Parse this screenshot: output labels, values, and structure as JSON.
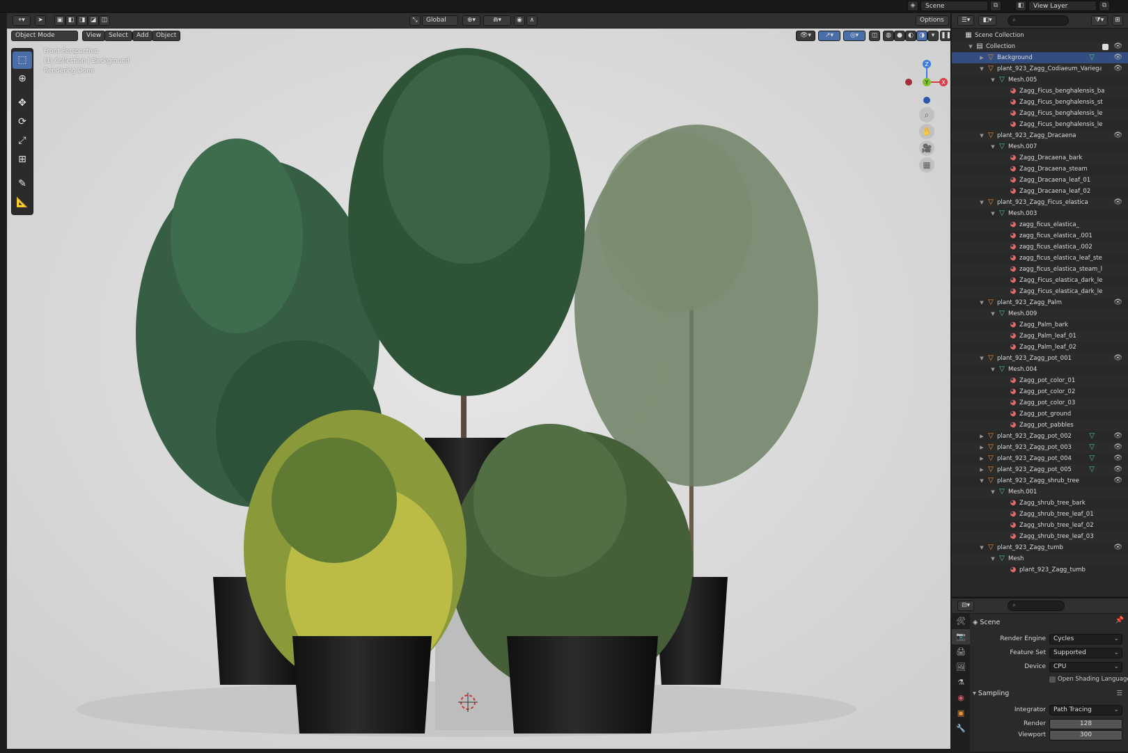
{
  "topbar": {
    "scene_label": "Scene",
    "view_layer_label": "View Layer"
  },
  "viewport": {
    "mode_label": "Object Mode",
    "menus": [
      "View",
      "Select",
      "Add",
      "Object"
    ],
    "transform_label": "Global",
    "options_label": "Options",
    "overlay_lines": [
      "Front Perspective",
      "(1) Collection | Background",
      "Rendering Done"
    ],
    "gizmo_axes": {
      "z": "Z",
      "y": "Y",
      "x": "X"
    },
    "colors": {
      "background": "#dcdcdc",
      "header": "#303030",
      "active_tool": "#4a6ea8"
    }
  },
  "outliner": {
    "search_placeholder": "",
    "rows": [
      {
        "label": "Scene Collection",
        "type": "scene",
        "depth": 0,
        "expand": ""
      },
      {
        "label": "Collection",
        "type": "collection",
        "depth": 1,
        "expand": "▼",
        "check": true,
        "eye": true
      },
      {
        "label": "Background",
        "type": "object",
        "depth": 2,
        "expand": "▶",
        "eye": true,
        "selected": true,
        "tail": "mesh"
      },
      {
        "label": "plant_923_Zagg_Codiaeum_Variega",
        "type": "object",
        "depth": 2,
        "expand": "▼",
        "eye": true
      },
      {
        "label": "Mesh.005",
        "type": "mesh",
        "depth": 3,
        "expand": "▼"
      },
      {
        "label": "Zagg_Ficus_benghalensis_ba",
        "type": "material",
        "depth": 4
      },
      {
        "label": "Zagg_Ficus_benghalensis_st",
        "type": "material",
        "depth": 4
      },
      {
        "label": "Zagg_Ficus_benghalensis_le",
        "type": "material",
        "depth": 4
      },
      {
        "label": "Zagg_Ficus_benghalensis_le",
        "type": "material",
        "depth": 4
      },
      {
        "label": "plant_923_Zagg_Dracaena",
        "type": "object",
        "depth": 2,
        "expand": "▼",
        "eye": true
      },
      {
        "label": "Mesh.007",
        "type": "mesh",
        "depth": 3,
        "expand": "▼"
      },
      {
        "label": "Zagg_Dracaena_bark",
        "type": "material",
        "depth": 4
      },
      {
        "label": "Zagg_Dracaena_steam",
        "type": "material",
        "depth": 4
      },
      {
        "label": "Zagg_Dracaena_leaf_01",
        "type": "material",
        "depth": 4
      },
      {
        "label": "Zagg_Dracaena_leaf_02",
        "type": "material",
        "depth": 4
      },
      {
        "label": "plant_923_Zagg_Ficus_elastica",
        "type": "object",
        "depth": 2,
        "expand": "▼",
        "eye": true
      },
      {
        "label": "Mesh.003",
        "type": "mesh",
        "depth": 3,
        "expand": "▼"
      },
      {
        "label": "zagg_ficus_elastica_",
        "type": "material",
        "depth": 4
      },
      {
        "label": "zagg_ficus_elastica_.001",
        "type": "material",
        "depth": 4
      },
      {
        "label": "zagg_ficus_elastica_.002",
        "type": "material",
        "depth": 4
      },
      {
        "label": "zagg_ficus_elastica_leaf_ste",
        "type": "material",
        "depth": 4
      },
      {
        "label": "zagg_ficus_elastica_steam_l",
        "type": "material",
        "depth": 4
      },
      {
        "label": "Zagg_Ficus_elastica_dark_le",
        "type": "material",
        "depth": 4
      },
      {
        "label": "Zagg_Ficus_elastica_dark_le",
        "type": "material",
        "depth": 4
      },
      {
        "label": "plant_923_Zagg_Palm",
        "type": "object",
        "depth": 2,
        "expand": "▼",
        "eye": true
      },
      {
        "label": "Mesh.009",
        "type": "mesh",
        "depth": 3,
        "expand": "▼"
      },
      {
        "label": "Zagg_Palm_bark",
        "type": "material",
        "depth": 4
      },
      {
        "label": "Zagg_Palm_leaf_01",
        "type": "material",
        "depth": 4
      },
      {
        "label": "Zagg_Palm_leaf_02",
        "type": "material",
        "depth": 4
      },
      {
        "label": "plant_923_Zagg_pot_001",
        "type": "object",
        "depth": 2,
        "expand": "▼",
        "eye": true
      },
      {
        "label": "Mesh.004",
        "type": "mesh",
        "depth": 3,
        "expand": "▼"
      },
      {
        "label": "Zagg_pot_color_01",
        "type": "material",
        "depth": 4
      },
      {
        "label": "Zagg_pot_color_02",
        "type": "material",
        "depth": 4
      },
      {
        "label": "Zagg_pot_color_03",
        "type": "material",
        "depth": 4
      },
      {
        "label": "Zagg_pot_ground",
        "type": "material",
        "depth": 4
      },
      {
        "label": "Zagg_pot_pabbles",
        "type": "material",
        "depth": 4
      },
      {
        "label": "plant_923_Zagg_pot_002",
        "type": "object",
        "depth": 2,
        "expand": "▶",
        "eye": true,
        "tail": "mesh"
      },
      {
        "label": "plant_923_Zagg_pot_003",
        "type": "object",
        "depth": 2,
        "expand": "▶",
        "eye": true,
        "tail": "mesh"
      },
      {
        "label": "plant_923_Zagg_pot_004",
        "type": "object",
        "depth": 2,
        "expand": "▶",
        "eye": true,
        "tail": "mesh"
      },
      {
        "label": "plant_923_Zagg_pot_005",
        "type": "object",
        "depth": 2,
        "expand": "▶",
        "eye": true,
        "tail": "mesh"
      },
      {
        "label": "plant_923_Zagg_shrub_tree",
        "type": "object",
        "depth": 2,
        "expand": "▼",
        "eye": true
      },
      {
        "label": "Mesh.001",
        "type": "mesh",
        "depth": 3,
        "expand": "▼"
      },
      {
        "label": "Zagg_shrub_tree_bark",
        "type": "material",
        "depth": 4
      },
      {
        "label": "Zagg_shrub_tree_leaf_01",
        "type": "material",
        "depth": 4
      },
      {
        "label": "Zagg_shrub_tree_leaf_02",
        "type": "material",
        "depth": 4
      },
      {
        "label": "Zagg_shrub_tree_leaf_03",
        "type": "material",
        "depth": 4
      },
      {
        "label": "plant_923_Zagg_tumb",
        "type": "object",
        "depth": 2,
        "expand": "▼",
        "eye": true
      },
      {
        "label": "Mesh",
        "type": "mesh",
        "depth": 3,
        "expand": "▼"
      },
      {
        "label": "plant_923_Zagg_tumb",
        "type": "material",
        "depth": 4
      }
    ]
  },
  "properties": {
    "context_label": "Scene",
    "render_engine_label": "Render Engine",
    "render_engine_value": "Cycles",
    "feature_set_label": "Feature Set",
    "feature_set_value": "Supported",
    "device_label": "Device",
    "device_value": "CPU",
    "osl_label": "Open Shading Language",
    "sampling_label": "Sampling",
    "integrator_label": "Integrator",
    "integrator_value": "Path Tracing",
    "render_label": "Render",
    "render_value": "128",
    "viewport_label": "Viewport",
    "viewport_value": "300"
  }
}
